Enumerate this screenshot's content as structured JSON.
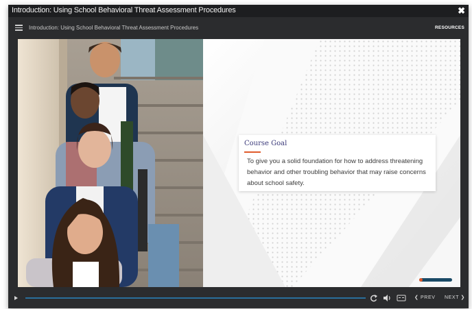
{
  "window": {
    "title": "Introduction: Using School Behavioral Threat Assessment Procedures",
    "close_glyph": "✖"
  },
  "header": {
    "course_title": "Introduction: Using School Behavioral Threat Assessment Procedures",
    "resources_label": "RESOURCES",
    "menu_icon": "hamburger-menu-icon"
  },
  "slide": {
    "photo_description_icon": "students-photo",
    "card": {
      "title": "Course Goal",
      "body": "To give you a solid foundation for how to address threatening behavior and other troubling behavior that may raise concerns about school safety."
    },
    "slide_progress": 0.1
  },
  "controls": {
    "play_icon": "play-icon",
    "seek_progress": 0.0,
    "replay_icon": "replay-icon",
    "volume_icon": "volume-icon",
    "captions_icon": "captions-icon",
    "prev_label": "PREV",
    "next_label": "NEXT"
  },
  "colors": {
    "accent": "#e05a2b",
    "title_text": "#3b3a7a",
    "seek_bar": "#5fb4e6",
    "chrome": "#2b2c2e"
  }
}
